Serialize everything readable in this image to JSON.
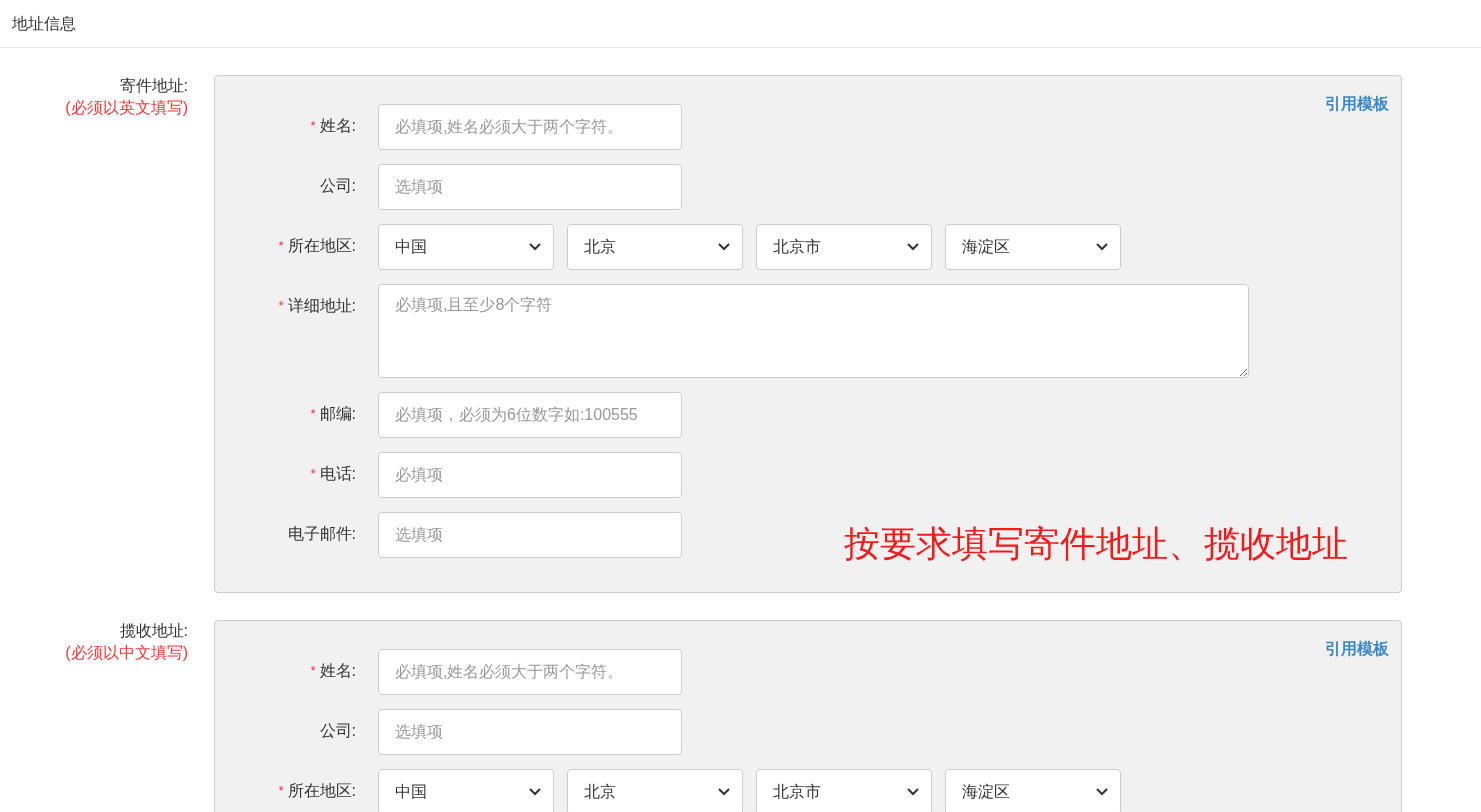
{
  "header": {
    "title": "地址信息"
  },
  "sections": [
    {
      "label": "寄件地址:",
      "note": "(必须以英文填写)",
      "template_link": "引用模板",
      "annotation": "按要求填写寄件地址、揽收地址",
      "fields": [
        {
          "kind": "input",
          "asterisk": "*",
          "label": "姓名:",
          "placeholder": "必填项,姓名必须大于两个字符。"
        },
        {
          "kind": "input",
          "label": "公司:",
          "placeholder": "选填项"
        },
        {
          "kind": "selects",
          "asterisk": "*",
          "label": "所在地区:",
          "values": [
            "中国",
            "北京",
            "北京市",
            "海淀区"
          ]
        },
        {
          "kind": "textarea",
          "asterisk": "*",
          "label": "详细地址:",
          "placeholder": "必填项,且至少8个字符"
        },
        {
          "kind": "input",
          "asterisk": "*",
          "label": "邮编:",
          "placeholder": "必填项，必须为6位数字如:100555"
        },
        {
          "kind": "input",
          "asterisk": "*",
          "label": "电话:",
          "placeholder": "必填项"
        },
        {
          "kind": "input",
          "label": "电子邮件:",
          "placeholder": "选填项"
        }
      ]
    },
    {
      "label": "揽收地址:",
      "note": "(必须以中文填写)",
      "template_link": "引用模板",
      "fields": [
        {
          "kind": "input",
          "asterisk": "*",
          "label": "姓名:",
          "placeholder": "必填项,姓名必须大于两个字符。"
        },
        {
          "kind": "input",
          "label": "公司:",
          "placeholder": "选填项"
        },
        {
          "kind": "selects",
          "asterisk": "*",
          "label": "所在地区:",
          "values": [
            "中国",
            "北京",
            "北京市",
            "海淀区"
          ]
        }
      ]
    }
  ]
}
